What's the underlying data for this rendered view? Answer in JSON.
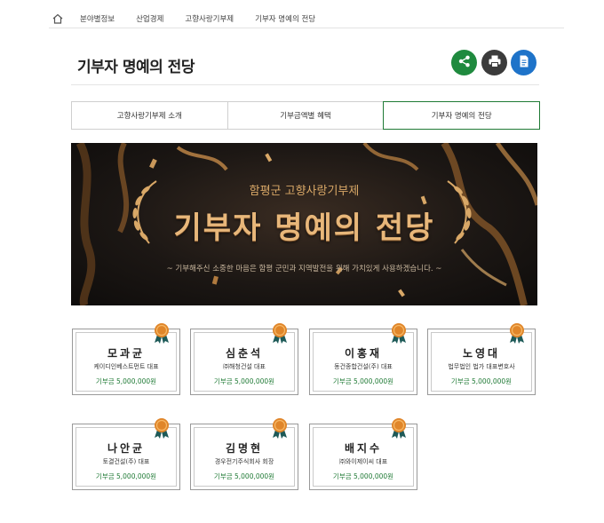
{
  "breadcrumb": {
    "items": [
      "분야별정보",
      "산업경제",
      "고향사랑기부제",
      "기부자 명예의 전당"
    ]
  },
  "page": {
    "title": "기부자 명예의 전당"
  },
  "actions": {
    "share": "share-icon",
    "print": "printer-icon",
    "document": "document-icon"
  },
  "tabs": [
    {
      "label": "고향사랑기부제 소개",
      "active": false
    },
    {
      "label": "기부금액별 혜택",
      "active": false
    },
    {
      "label": "기부자 명예의 전당",
      "active": true
    }
  ],
  "banner": {
    "subtitle": "함평군 고향사랑기부제",
    "title": "기부자 명예의 전당",
    "caption": "~ 기부해주신 소중한 마음은 함평 군민과 지역발전을 위해 가치있게 사용하겠습니다. ~"
  },
  "donors": [
    {
      "name": "모과균",
      "org": "케이디인베스트먼트 대표",
      "amount": "기부금 5,000,000원"
    },
    {
      "name": "심춘석",
      "org": "㈜해청건설 대표",
      "amount": "기부금 5,000,000원"
    },
    {
      "name": "이홍재",
      "org": "동건종합건설(주) 대표",
      "amount": "기부금 5,000,000원"
    },
    {
      "name": "노영대",
      "org": "법무법인 법가 대표변호사",
      "amount": "기부금 5,000,000원"
    },
    {
      "name": "나안균",
      "org": "토결건설(주) 대표",
      "amount": "기부금 5,000,000원"
    },
    {
      "name": "김명현",
      "org": "경우전기주식회사 회장",
      "amount": "기부금 5,000,000원"
    },
    {
      "name": "배지수",
      "org": "㈜와이제이씨 대표",
      "amount": "기부금 5,000,000원"
    }
  ],
  "colors": {
    "accent_green": "#1f7a35",
    "share": "#1f8a3e",
    "print": "#3b3b3b",
    "document": "#1e73c9",
    "banner_gold": "#e8b77a"
  }
}
